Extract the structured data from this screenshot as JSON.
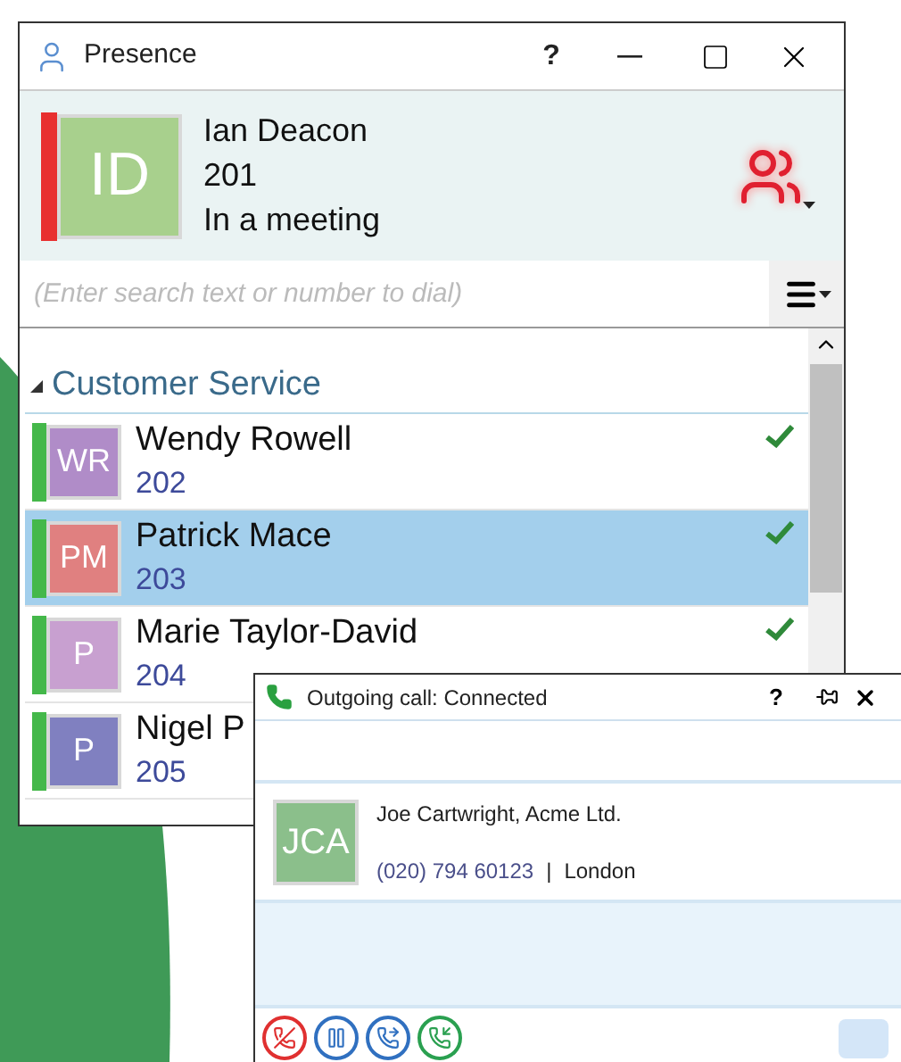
{
  "window": {
    "title": "Presence",
    "help": "?"
  },
  "me": {
    "initials": "ID",
    "color": "#a8d08d",
    "status_bar": {
      "color": "#e83030"
    },
    "name": "Ian Deacon",
    "extension": "201",
    "status_text": "In a meeting"
  },
  "search": {
    "placeholder": "(Enter search text or number to dial)"
  },
  "groups": [
    {
      "name": "Customer Service",
      "expanded": true,
      "contacts": [
        {
          "initials": "WR",
          "color": "#b08cc8",
          "status_bar": {
            "color": "#44b84a"
          },
          "available": true,
          "selected": false,
          "name": "Wendy Rowell",
          "extension": "202"
        },
        {
          "initials": "PM",
          "color": "#e08080",
          "status_bar": {
            "color": "#44b84a"
          },
          "available": true,
          "selected": true,
          "name": "Patrick Mace",
          "extension": "203"
        },
        {
          "initials": "P",
          "color": "#c8a0d0",
          "status_bar": {
            "color": "#44b84a"
          },
          "available": true,
          "selected": false,
          "name": "Marie Taylor-David",
          "extension": "204"
        },
        {
          "initials": "P",
          "color": "#8080c0",
          "status_bar": {
            "color": "#44b84a"
          },
          "selected": false,
          "name": "Nigel P",
          "extension": "205"
        }
      ]
    }
  ],
  "call_window": {
    "title": "Outgoing call: Connected",
    "help": "?",
    "contact": {
      "initials": "JCA",
      "color": "#8bbf8b",
      "name": "Joe Cartwright, Acme Ltd.",
      "phone": "(020) 794 60123",
      "separator": "|",
      "location": "London"
    }
  }
}
